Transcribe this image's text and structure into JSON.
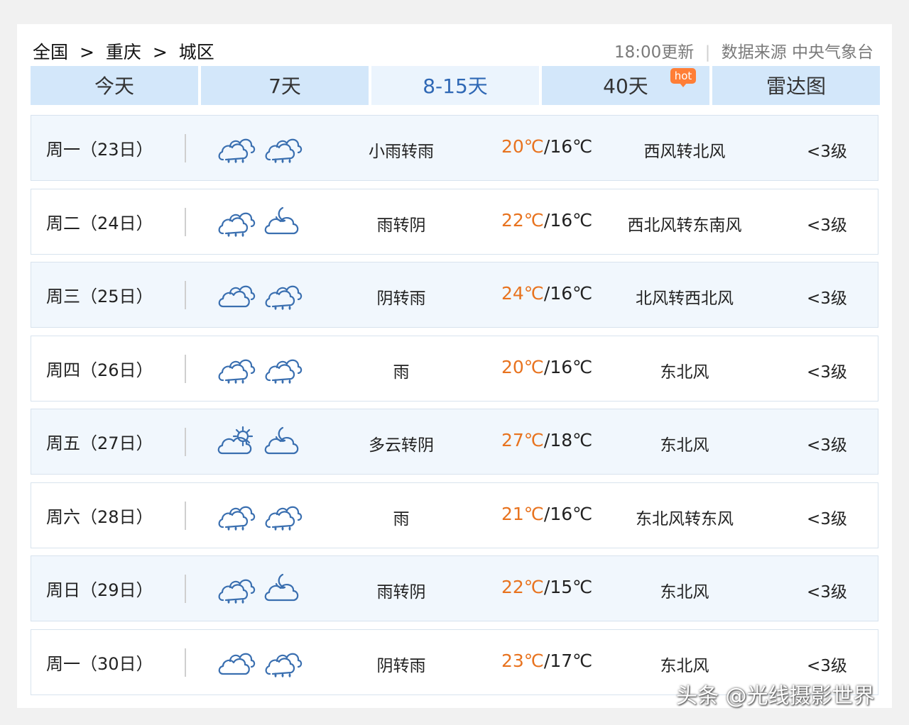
{
  "breadcrumb": {
    "items": [
      "全国",
      "重庆",
      "城区"
    ],
    "separator": ">"
  },
  "update": {
    "time_text": "18:00更新",
    "source_text": "数据来源 中央气象台"
  },
  "tabs": [
    {
      "label": "今天",
      "active": false
    },
    {
      "label": "7天",
      "active": false
    },
    {
      "label": "8-15天",
      "active": true
    },
    {
      "label": "40天",
      "active": false,
      "badge": "hot"
    },
    {
      "label": "雷达图",
      "active": false
    }
  ],
  "forecast": [
    {
      "day": "周一（23日）",
      "icon_day": "rain-icon",
      "icon_night": "rain-icon",
      "desc": "小雨转雨",
      "high": "20℃",
      "sep": "/",
      "low": "16℃",
      "wind": "西风转北风",
      "level": "<3级"
    },
    {
      "day": "周二（24日）",
      "icon_day": "rain-icon",
      "icon_night": "overcast-night-icon",
      "desc": "雨转阴",
      "high": "22℃",
      "sep": "/",
      "low": "16℃",
      "wind": "西北风转东南风",
      "level": "<3级"
    },
    {
      "day": "周三（25日）",
      "icon_day": "overcast-icon",
      "icon_night": "rain-icon",
      "desc": "阴转雨",
      "high": "24℃",
      "sep": "/",
      "low": "16℃",
      "wind": "北风转西北风",
      "level": "<3级"
    },
    {
      "day": "周四（26日）",
      "icon_day": "rain-icon",
      "icon_night": "rain-icon",
      "desc": "雨",
      "high": "20℃",
      "sep": "/",
      "low": "16℃",
      "wind": "东北风",
      "level": "<3级"
    },
    {
      "day": "周五（27日）",
      "icon_day": "partly-cloudy-icon",
      "icon_night": "overcast-night-icon",
      "desc": "多云转阴",
      "high": "27℃",
      "sep": "/",
      "low": "18℃",
      "wind": "东北风",
      "level": "<3级"
    },
    {
      "day": "周六（28日）",
      "icon_day": "rain-icon",
      "icon_night": "rain-icon",
      "desc": "雨",
      "high": "21℃",
      "sep": "/",
      "low": "16℃",
      "wind": "东北风转东风",
      "level": "<3级"
    },
    {
      "day": "周日（29日）",
      "icon_day": "rain-icon",
      "icon_night": "overcast-night-icon",
      "desc": "雨转阴",
      "high": "22℃",
      "sep": "/",
      "low": "15℃",
      "wind": "东北风",
      "level": "<3级"
    },
    {
      "day": "周一（30日）",
      "icon_day": "overcast-icon",
      "icon_night": "rain-icon",
      "desc": "阴转雨",
      "high": "23℃",
      "sep": "/",
      "low": "17℃",
      "wind": "东北风",
      "level": "<3级"
    }
  ],
  "watermark": "头条 @光线摄影世界",
  "colors": {
    "tab_bg": "#d3e7fa",
    "tab_active_bg": "#ebf4fd",
    "tab_active_text": "#2f68b5",
    "row_alt_bg": "#f1f7fd",
    "high_temp": "#e8731f",
    "icon_stroke": "#3a6fb0",
    "hot_badge": "#ff7e36"
  }
}
